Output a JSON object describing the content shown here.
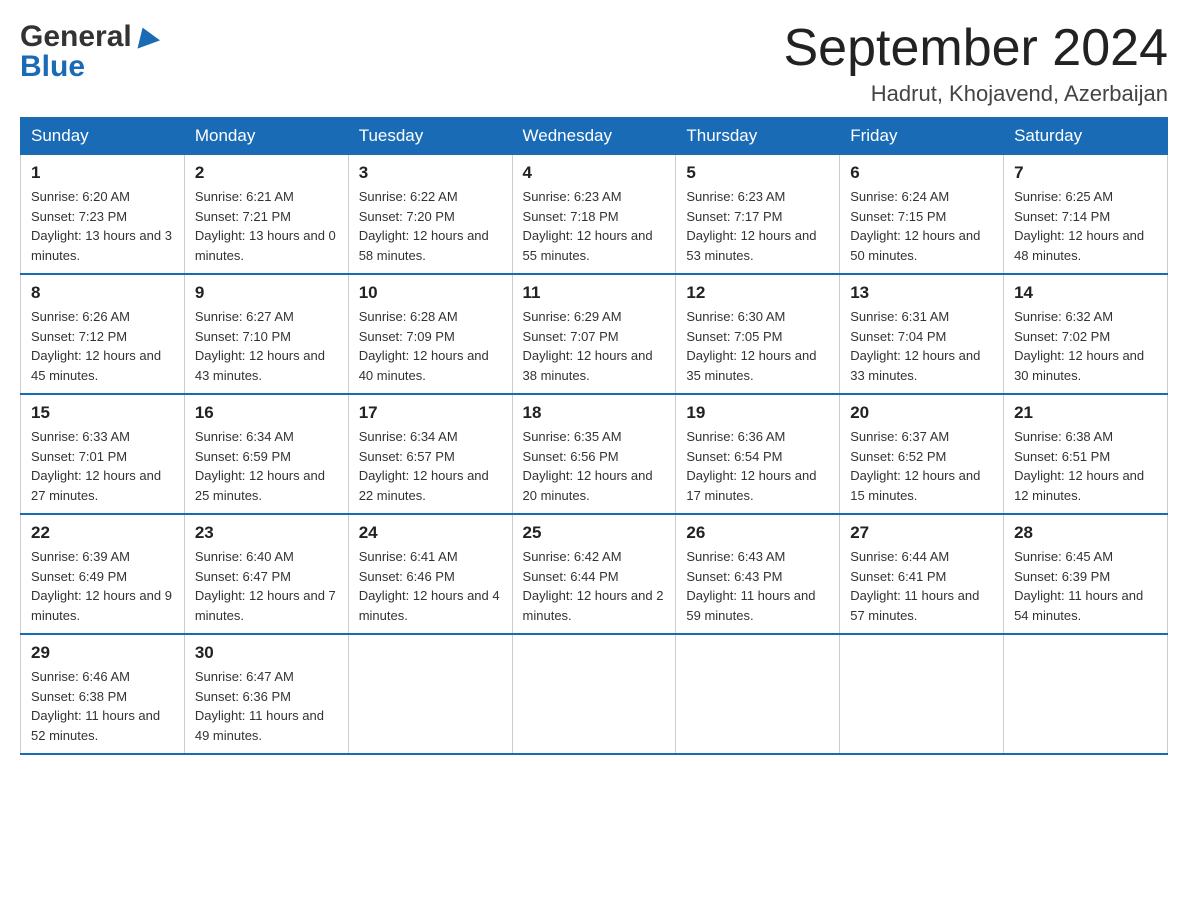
{
  "logo": {
    "general": "General",
    "blue": "Blue",
    "triangle_label": "logo-triangle"
  },
  "title": {
    "month_year": "September 2024",
    "location": "Hadrut, Khojavend, Azerbaijan"
  },
  "days_of_week": [
    "Sunday",
    "Monday",
    "Tuesday",
    "Wednesday",
    "Thursday",
    "Friday",
    "Saturday"
  ],
  "weeks": [
    [
      {
        "day": "1",
        "sunrise": "6:20 AM",
        "sunset": "7:23 PM",
        "daylight": "13 hours and 3 minutes."
      },
      {
        "day": "2",
        "sunrise": "6:21 AM",
        "sunset": "7:21 PM",
        "daylight": "13 hours and 0 minutes."
      },
      {
        "day": "3",
        "sunrise": "6:22 AM",
        "sunset": "7:20 PM",
        "daylight": "12 hours and 58 minutes."
      },
      {
        "day": "4",
        "sunrise": "6:23 AM",
        "sunset": "7:18 PM",
        "daylight": "12 hours and 55 minutes."
      },
      {
        "day": "5",
        "sunrise": "6:23 AM",
        "sunset": "7:17 PM",
        "daylight": "12 hours and 53 minutes."
      },
      {
        "day": "6",
        "sunrise": "6:24 AM",
        "sunset": "7:15 PM",
        "daylight": "12 hours and 50 minutes."
      },
      {
        "day": "7",
        "sunrise": "6:25 AM",
        "sunset": "7:14 PM",
        "daylight": "12 hours and 48 minutes."
      }
    ],
    [
      {
        "day": "8",
        "sunrise": "6:26 AM",
        "sunset": "7:12 PM",
        "daylight": "12 hours and 45 minutes."
      },
      {
        "day": "9",
        "sunrise": "6:27 AM",
        "sunset": "7:10 PM",
        "daylight": "12 hours and 43 minutes."
      },
      {
        "day": "10",
        "sunrise": "6:28 AM",
        "sunset": "7:09 PM",
        "daylight": "12 hours and 40 minutes."
      },
      {
        "day": "11",
        "sunrise": "6:29 AM",
        "sunset": "7:07 PM",
        "daylight": "12 hours and 38 minutes."
      },
      {
        "day": "12",
        "sunrise": "6:30 AM",
        "sunset": "7:05 PM",
        "daylight": "12 hours and 35 minutes."
      },
      {
        "day": "13",
        "sunrise": "6:31 AM",
        "sunset": "7:04 PM",
        "daylight": "12 hours and 33 minutes."
      },
      {
        "day": "14",
        "sunrise": "6:32 AM",
        "sunset": "7:02 PM",
        "daylight": "12 hours and 30 minutes."
      }
    ],
    [
      {
        "day": "15",
        "sunrise": "6:33 AM",
        "sunset": "7:01 PM",
        "daylight": "12 hours and 27 minutes."
      },
      {
        "day": "16",
        "sunrise": "6:34 AM",
        "sunset": "6:59 PM",
        "daylight": "12 hours and 25 minutes."
      },
      {
        "day": "17",
        "sunrise": "6:34 AM",
        "sunset": "6:57 PM",
        "daylight": "12 hours and 22 minutes."
      },
      {
        "day": "18",
        "sunrise": "6:35 AM",
        "sunset": "6:56 PM",
        "daylight": "12 hours and 20 minutes."
      },
      {
        "day": "19",
        "sunrise": "6:36 AM",
        "sunset": "6:54 PM",
        "daylight": "12 hours and 17 minutes."
      },
      {
        "day": "20",
        "sunrise": "6:37 AM",
        "sunset": "6:52 PM",
        "daylight": "12 hours and 15 minutes."
      },
      {
        "day": "21",
        "sunrise": "6:38 AM",
        "sunset": "6:51 PM",
        "daylight": "12 hours and 12 minutes."
      }
    ],
    [
      {
        "day": "22",
        "sunrise": "6:39 AM",
        "sunset": "6:49 PM",
        "daylight": "12 hours and 9 minutes."
      },
      {
        "day": "23",
        "sunrise": "6:40 AM",
        "sunset": "6:47 PM",
        "daylight": "12 hours and 7 minutes."
      },
      {
        "day": "24",
        "sunrise": "6:41 AM",
        "sunset": "6:46 PM",
        "daylight": "12 hours and 4 minutes."
      },
      {
        "day": "25",
        "sunrise": "6:42 AM",
        "sunset": "6:44 PM",
        "daylight": "12 hours and 2 minutes."
      },
      {
        "day": "26",
        "sunrise": "6:43 AM",
        "sunset": "6:43 PM",
        "daylight": "11 hours and 59 minutes."
      },
      {
        "day": "27",
        "sunrise": "6:44 AM",
        "sunset": "6:41 PM",
        "daylight": "11 hours and 57 minutes."
      },
      {
        "day": "28",
        "sunrise": "6:45 AM",
        "sunset": "6:39 PM",
        "daylight": "11 hours and 54 minutes."
      }
    ],
    [
      {
        "day": "29",
        "sunrise": "6:46 AM",
        "sunset": "6:38 PM",
        "daylight": "11 hours and 52 minutes."
      },
      {
        "day": "30",
        "sunrise": "6:47 AM",
        "sunset": "6:36 PM",
        "daylight": "11 hours and 49 minutes."
      },
      null,
      null,
      null,
      null,
      null
    ]
  ]
}
